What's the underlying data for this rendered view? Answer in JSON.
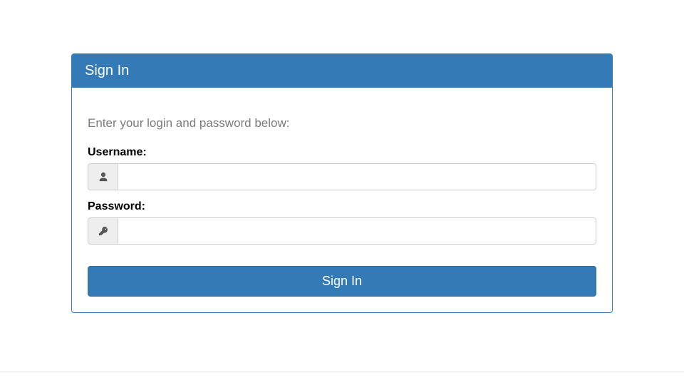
{
  "panel": {
    "heading": "Sign In",
    "instructions": "Enter your login and password below:",
    "username_label": "Username:",
    "password_label": "Password:",
    "username_value": "",
    "password_value": "",
    "submit_label": "Sign In"
  },
  "icons": {
    "user": "user-icon",
    "key": "key-icon"
  },
  "colors": {
    "primary": "#337ab7",
    "addon_bg": "#eeeeee",
    "border": "#cccccc",
    "muted_text": "#7b7b7b"
  }
}
